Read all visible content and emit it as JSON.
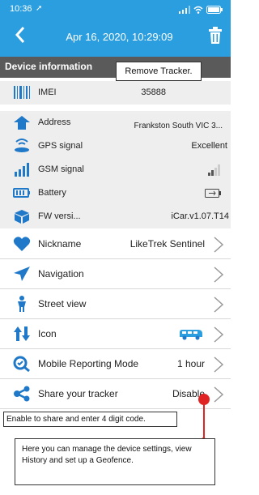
{
  "status_bar": {
    "time": "10:36",
    "colors": {
      "bar": "#2b9ee0"
    }
  },
  "header": {
    "title": "Apr 16, 2020, 10:29:09"
  },
  "section": {
    "title": "Device information"
  },
  "tooltips": {
    "remove": "Remove Tracker.",
    "share": "Enable to share and enter 4 digit code.",
    "manage": "Here you can manage the device settings, view History and set up a Geofence."
  },
  "info_rows": [
    {
      "label": "IMEI",
      "value": "35888",
      "icon": "barcode-icon"
    },
    {
      "label": "Address",
      "value": "Frankston South VIC 3...",
      "icon": "house-icon"
    },
    {
      "label": "GPS signal",
      "value": "Excellent",
      "icon": "gps-icon"
    },
    {
      "label": "GSM signal",
      "value": "",
      "icon": "gsm-signal-icon"
    },
    {
      "label": "Battery",
      "value": "",
      "icon": "battery-icon"
    },
    {
      "label": "FW versi...",
      "value": "iCar.v1.07.T14",
      "icon": "cube-icon"
    }
  ],
  "settings": [
    {
      "label": "Nickname",
      "value": "LikeTrek Sentinel",
      "icon": "heart-icon"
    },
    {
      "label": "Navigation",
      "value": "",
      "icon": "navigation-icon"
    },
    {
      "label": "Street view",
      "value": "",
      "icon": "person-icon"
    },
    {
      "label": "Icon",
      "value": "",
      "icon": "icon-swap-icon"
    },
    {
      "label": "Mobile Reporting Mode",
      "value": "1 hour",
      "icon": "search-icon"
    },
    {
      "label": "Share your tracker",
      "value": "Disable",
      "icon": "share-icon"
    }
  ]
}
